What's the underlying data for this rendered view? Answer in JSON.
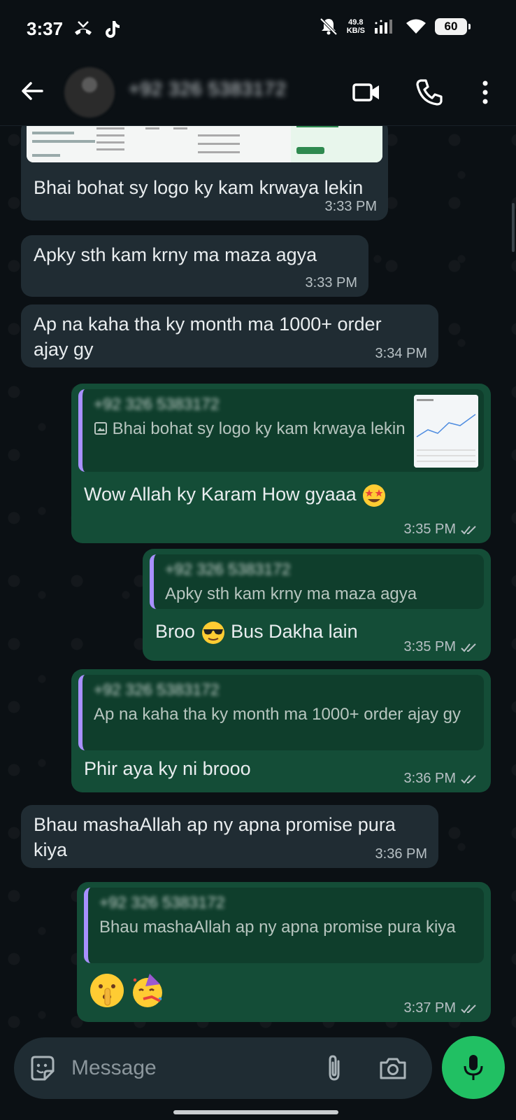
{
  "status_bar": {
    "time": "3:37",
    "net_speed_value": "49.8",
    "net_speed_unit": "KB/S",
    "battery": "60",
    "icons": [
      "missed-call-icon",
      "tiktok-icon",
      "mute-icon",
      "signal-icon",
      "wifi-icon",
      "battery-icon"
    ]
  },
  "header": {
    "contact_name": "+92 326 5383172",
    "icons": [
      "back-arrow-icon",
      "video-call-icon",
      "voice-call-icon",
      "more-options-icon"
    ]
  },
  "messages": [
    {
      "dir": "in",
      "text": "Bhai bohat sy logo ky kam krwaya lekin",
      "time": "3:33 PM",
      "has_image_preview": true
    },
    {
      "dir": "in",
      "text": "Apky sth kam krny ma maza agya",
      "time": "3:33 PM"
    },
    {
      "dir": "in",
      "text": "Ap na kaha tha ky month ma 1000+ order ajay gy",
      "time": "3:34 PM"
    },
    {
      "dir": "out",
      "quote_author": "+92 326 5383172",
      "quote_text": "Bhai bohat sy logo ky kam krwaya lekin",
      "text": "Wow Allah ky Karam How gyaaa",
      "emoji": "star-struck-emoji",
      "time": "3:35 PM",
      "status": "read"
    },
    {
      "dir": "out",
      "quote_author": "+92 326 5383172",
      "quote_text": "Apky sth kam krny ma maza agya",
      "text_before": "Broo",
      "emoji": "sunglasses-emoji",
      "text_after": "Bus Dakha lain",
      "time": "3:35 PM",
      "status": "read"
    },
    {
      "dir": "out",
      "quote_author": "+92 326 5383172",
      "quote_text": "Ap na kaha tha ky month ma 1000+ order ajay gy",
      "text": "Phir aya ky ni brooo",
      "time": "3:36 PM",
      "status": "read"
    },
    {
      "dir": "in",
      "text": "Bhau mashaAllah ap ny apna promise pura kiya",
      "time": "3:36 PM"
    },
    {
      "dir": "out",
      "quote_author": "+92 326 5383172",
      "quote_text": "Bhau mashaAllah ap ny apna promise pura kiya",
      "emojis": [
        "shushing-face-emoji",
        "partying-face-emoji"
      ],
      "time": "3:37 PM",
      "status": "read"
    }
  ],
  "input": {
    "placeholder": "Message",
    "icons": [
      "sticker-icon",
      "attach-icon",
      "camera-icon",
      "mic-icon"
    ]
  },
  "colors": {
    "background": "#0b1014",
    "incoming_bubble": "#202c33",
    "outgoing_bubble": "#144d37",
    "quote_bar": "#a890ff",
    "mic_button": "#21c063"
  }
}
